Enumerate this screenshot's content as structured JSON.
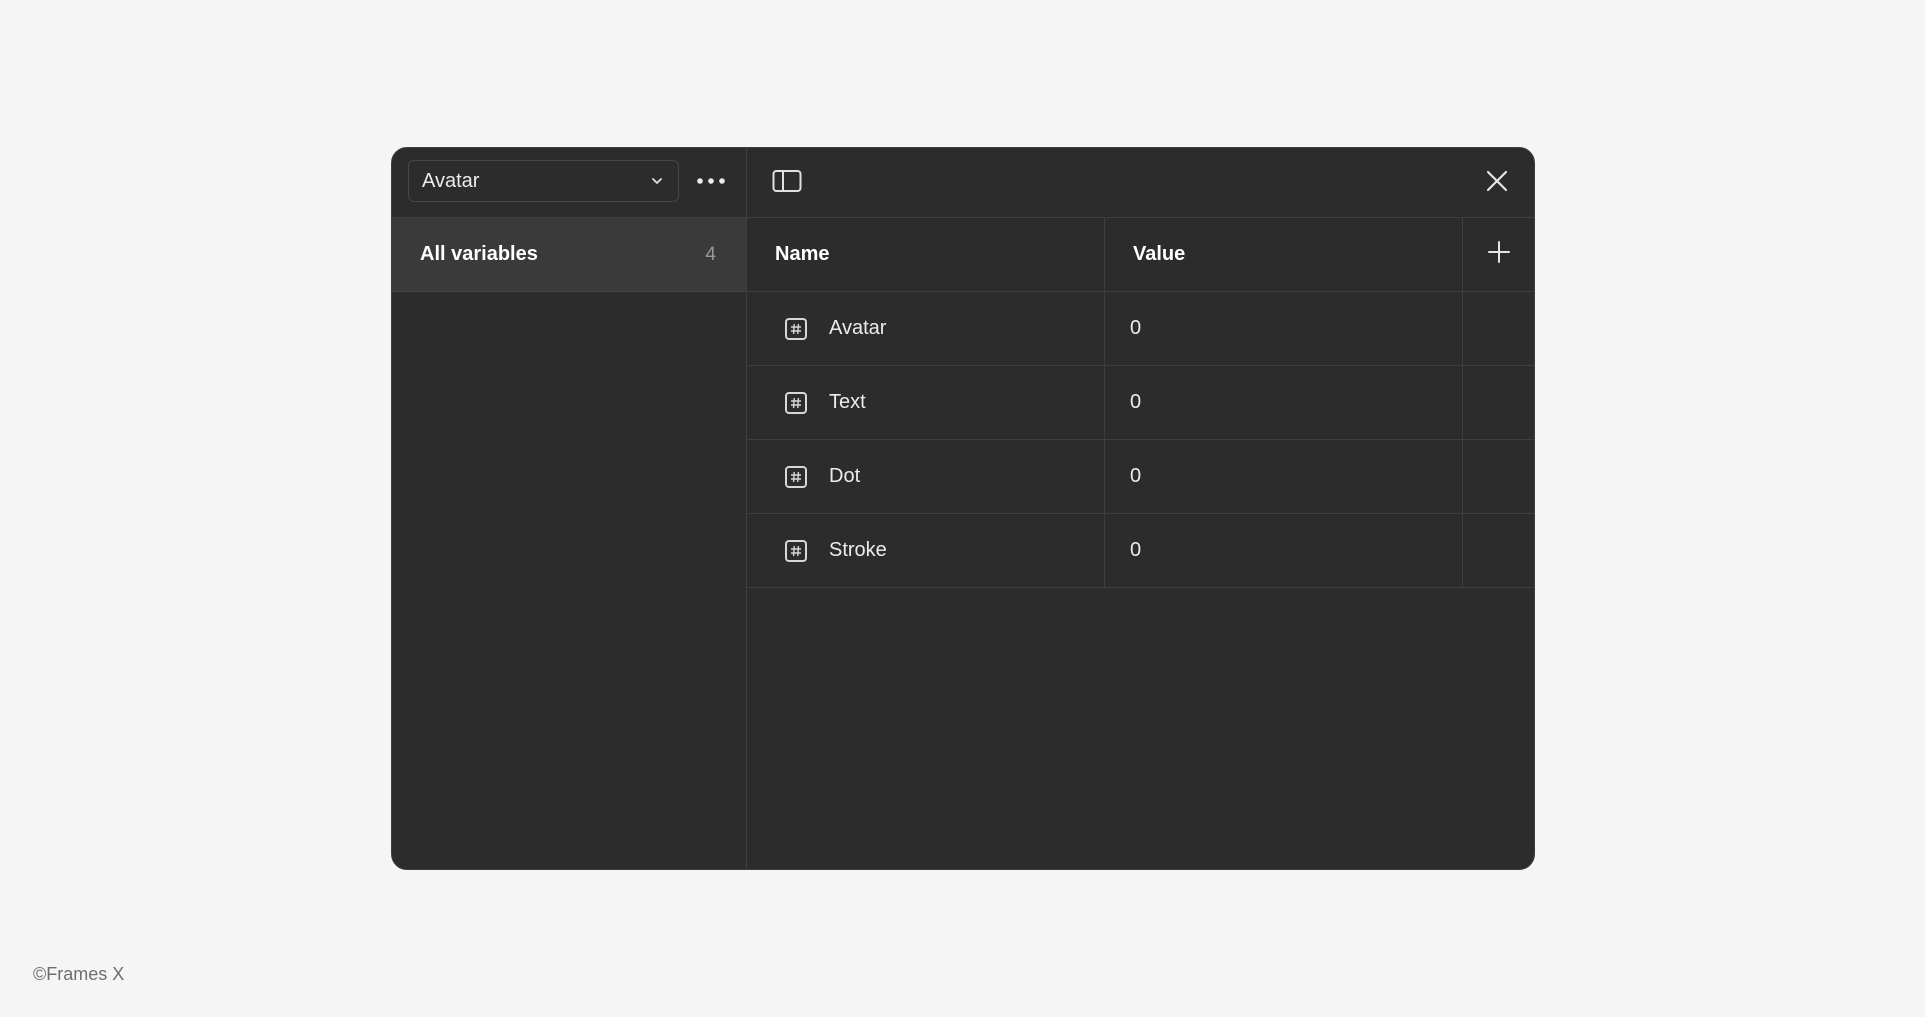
{
  "collection_select": {
    "selected": "Avatar"
  },
  "sidebar": {
    "items": [
      {
        "label": "All variables",
        "count": "4"
      }
    ]
  },
  "table": {
    "headers": {
      "name": "Name",
      "value": "Value"
    },
    "rows": [
      {
        "name": "Avatar",
        "value": "0",
        "type_icon": "number-icon"
      },
      {
        "name": "Text",
        "value": "0",
        "type_icon": "number-icon"
      },
      {
        "name": "Dot",
        "value": "0",
        "type_icon": "number-icon"
      },
      {
        "name": "Stroke",
        "value": "0",
        "type_icon": "number-icon"
      }
    ]
  },
  "footer": {
    "credit": "©Frames X"
  },
  "colors": {
    "page_background": "#f5f5f5",
    "panel_background": "#2c2c2c",
    "selected_item_background": "#3a3a3a",
    "text_primary": "#ececec",
    "text_muted": "#9a9a9a"
  }
}
